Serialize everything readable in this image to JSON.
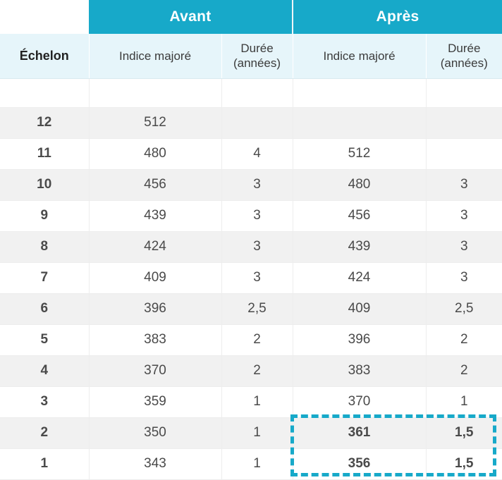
{
  "table": {
    "groups": [
      {
        "label": "",
        "key": "echelon-blank"
      },
      {
        "label": "Avant",
        "key": "avant"
      },
      {
        "label": "Après",
        "key": "apres"
      }
    ],
    "group_before": "Avant",
    "group_after": "Après",
    "columns": [
      "Échelon",
      "Indice majoré",
      "Durée\n(années)",
      "Indice majoré",
      "Durée\n(années)"
    ],
    "col_echelon": "Échelon",
    "col_indice_avant": "Indice majoré",
    "col_duree_avant_l1": "Durée",
    "col_duree_avant_l2": "(années)",
    "col_indice_apres": "Indice majoré",
    "col_duree_apres_l1": "Durée",
    "col_duree_apres_l2": "(années)",
    "rows": [
      {
        "echelon": "12",
        "indice_avant": "512",
        "duree_avant": "",
        "indice_apres": "",
        "duree_apres": "",
        "highlight": false
      },
      {
        "echelon": "11",
        "indice_avant": "480",
        "duree_avant": "4",
        "indice_apres": "512",
        "duree_apres": "",
        "highlight": false
      },
      {
        "echelon": "10",
        "indice_avant": "456",
        "duree_avant": "3",
        "indice_apres": "480",
        "duree_apres": "3",
        "highlight": false
      },
      {
        "echelon": "9",
        "indice_avant": "439",
        "duree_avant": "3",
        "indice_apres": "456",
        "duree_apres": "3",
        "highlight": false
      },
      {
        "echelon": "8",
        "indice_avant": "424",
        "duree_avant": "3",
        "indice_apres": "439",
        "duree_apres": "3",
        "highlight": false
      },
      {
        "echelon": "7",
        "indice_avant": "409",
        "duree_avant": "3",
        "indice_apres": "424",
        "duree_apres": "3",
        "highlight": false
      },
      {
        "echelon": "6",
        "indice_avant": "396",
        "duree_avant": "2,5",
        "indice_apres": "409",
        "duree_apres": "2,5",
        "highlight": false
      },
      {
        "echelon": "5",
        "indice_avant": "383",
        "duree_avant": "2",
        "indice_apres": "396",
        "duree_apres": "2",
        "highlight": false
      },
      {
        "echelon": "4",
        "indice_avant": "370",
        "duree_avant": "2",
        "indice_apres": "383",
        "duree_apres": "2",
        "highlight": false
      },
      {
        "echelon": "3",
        "indice_avant": "359",
        "duree_avant": "1",
        "indice_apres": "370",
        "duree_apres": "1",
        "highlight": false
      },
      {
        "echelon": "2",
        "indice_avant": "350",
        "duree_avant": "1",
        "indice_apres": "361",
        "duree_apres": "1,5",
        "highlight": true
      },
      {
        "echelon": "1",
        "indice_avant": "343",
        "duree_avant": "1",
        "indice_apres": "356",
        "duree_apres": "1,5",
        "highlight": true
      }
    ]
  },
  "colors": {
    "accent": "#17a9c9",
    "header_band_bg": "#e6f5fa",
    "row_stripe": "#f1f1f1",
    "text": "#4a4a4a",
    "highlight_border": "#17a9c9"
  }
}
